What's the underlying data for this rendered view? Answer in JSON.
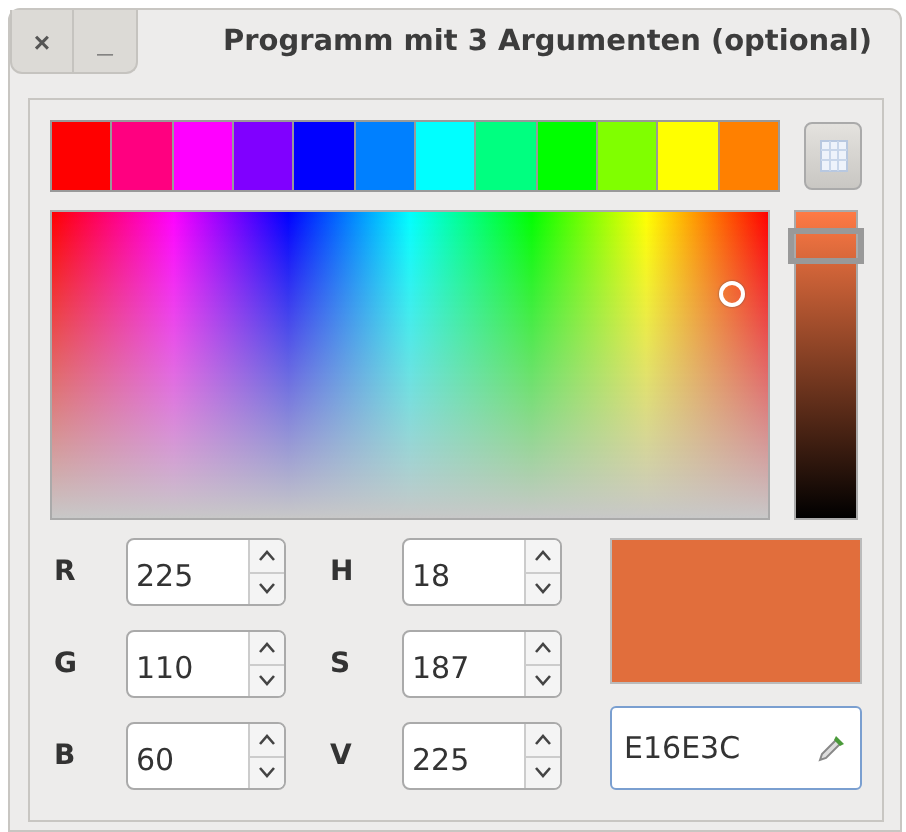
{
  "window": {
    "title": "Programm mit 3 Argumenten (optional)",
    "buttons": [
      {
        "kind": "close",
        "label": "×"
      },
      {
        "kind": "minimize",
        "label": "_"
      }
    ]
  },
  "swatches": [
    {
      "color": "#ff0000"
    },
    {
      "color": "#ff0080"
    },
    {
      "color": "#ff00ff"
    },
    {
      "color": "#8000ff"
    },
    {
      "color": "#0000ff"
    },
    {
      "color": "#0080ff"
    },
    {
      "color": "#00ffff"
    },
    {
      "color": "#00ff80"
    },
    {
      "color": "#00ff00"
    },
    {
      "color": "#80ff00"
    },
    {
      "color": "#ffff00"
    },
    {
      "color": "#ff8000"
    }
  ],
  "value_slider": {
    "level": 0.89
  },
  "rgb_fields": [
    {
      "label": "R",
      "value": "225"
    },
    {
      "label": "G",
      "value": "110"
    },
    {
      "label": "B",
      "value": "60"
    }
  ],
  "hsv_fields": [
    {
      "label": "H",
      "value": "18"
    },
    {
      "label": "S",
      "value": "187"
    },
    {
      "label": "V",
      "value": "225"
    }
  ],
  "hex_field": {
    "value": "E16E3C"
  }
}
